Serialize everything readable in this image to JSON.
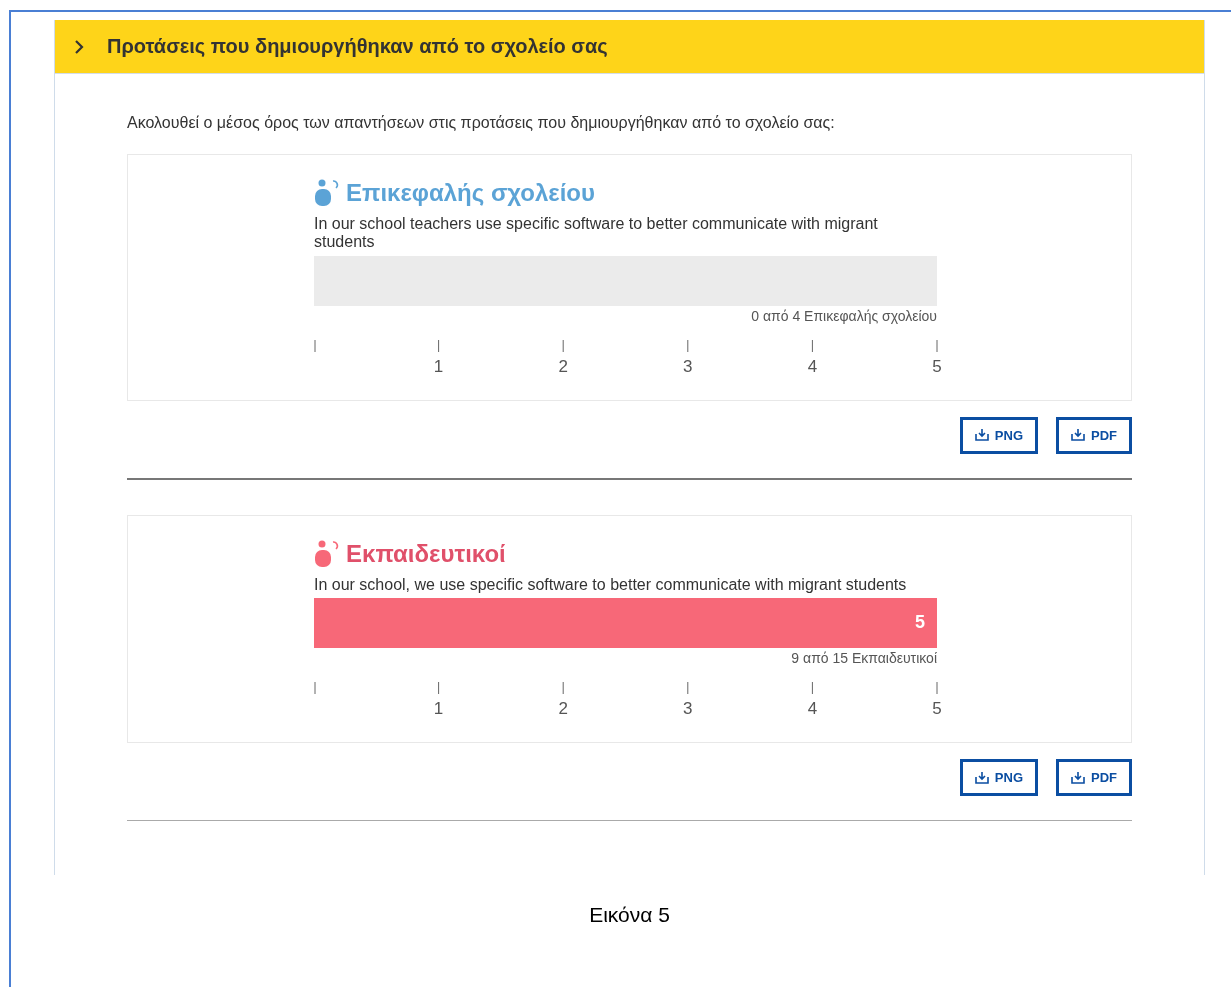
{
  "section": {
    "title": "Προτάσεις που δημιουργήθηκαν από το σχολείο σας",
    "expanded": false
  },
  "intro": "Ακολουθεί ο μέσος όρος των απαντήσεων στις προτάσεις που δημιουργήθηκαν από το σχολείο σας:",
  "groups": [
    {
      "name": "Επικεφαλής σχολείου",
      "color": "#5ba3d6",
      "question": "In our school teachers use specific software to better communicate with migrant students",
      "level": 0,
      "respondents": "0 από 4 Επικεφαλής σχολείου",
      "scale": [
        "1",
        "2",
        "3",
        "4",
        "5"
      ],
      "buttons": [
        "PNG",
        "PDF"
      ]
    },
    {
      "name": "Εκπαιδευτικοί",
      "color": "#f76878",
      "question": "In our school, we use specific software to better communicate with migrant students",
      "level": 1,
      "value_label": "5",
      "respondents": "9 από 15 Εκπαιδευτικοί",
      "scale": [
        "1",
        "2",
        "3",
        "4",
        "5"
      ],
      "buttons": [
        "PNG",
        "PDF"
      ]
    }
  ],
  "caption": "Εικόνα 5"
}
